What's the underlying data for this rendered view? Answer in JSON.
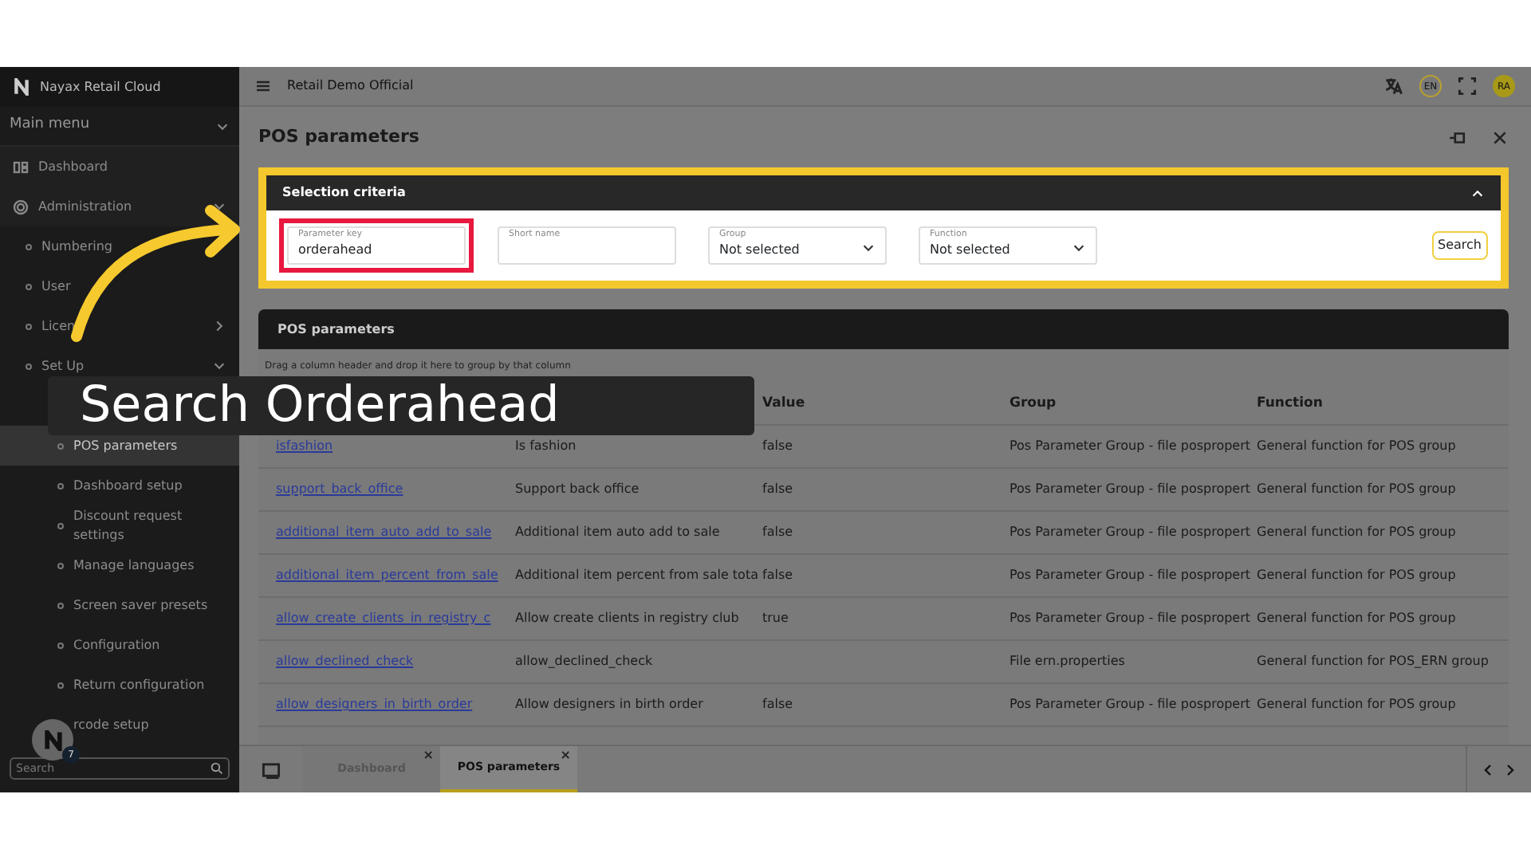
{
  "sidebar": {
    "brand": "Nayax Retail Cloud",
    "main_menu": "Main menu",
    "search": {
      "placeholder": "Search"
    },
    "help_badge": "7",
    "items": [
      {
        "label": "Dashboard",
        "kind": "top",
        "selected": false
      },
      {
        "label": "Administration",
        "kind": "top",
        "expanded": true,
        "selected": false,
        "children": [
          {
            "label": "Numbering",
            "kind": "sub",
            "expanded": false,
            "selected": false
          },
          {
            "label": "User",
            "kind": "sub",
            "selected": false
          },
          {
            "label": "Licen",
            "kind": "sub",
            "expanded": false,
            "selected": false
          },
          {
            "label": "Set Up",
            "kind": "sub",
            "expanded": true,
            "selected": false,
            "children": [
              {
                "label": "POS parameters",
                "kind": "leaf",
                "selected": true
              },
              {
                "label": "Dashboard setup",
                "kind": "leaf",
                "selected": false
              },
              {
                "label": "Discount request settings",
                "kind": "leaf",
                "selected": false
              },
              {
                "label": "Manage languages",
                "kind": "leaf",
                "selected": false
              },
              {
                "label": "Screen saver presets",
                "kind": "leaf",
                "selected": false
              },
              {
                "label": "Configuration",
                "kind": "leaf",
                "selected": false
              },
              {
                "label": "Return configuration",
                "kind": "leaf",
                "selected": false
              },
              {
                "label": "rcode setup",
                "kind": "leaf",
                "selected": false
              }
            ]
          }
        ]
      }
    ]
  },
  "topbar": {
    "title": "Retail Demo Official",
    "language": "EN",
    "avatar": "RA"
  },
  "page": {
    "title": "POS parameters"
  },
  "selection": {
    "title": "Selection criteria",
    "expanded": true,
    "fields": [
      {
        "kind": "text",
        "label": "Parameter key",
        "value": "orderahead",
        "highlighted": true
      },
      {
        "kind": "text",
        "label": "Short name",
        "highlighted": false
      },
      {
        "kind": "select",
        "label": "Group",
        "value": "Not selected",
        "highlighted": false
      },
      {
        "kind": "select",
        "label": "Function",
        "value": "Not selected",
        "highlighted": false
      }
    ],
    "button": "Search"
  },
  "grid": {
    "title": "POS parameters",
    "group_hint": "Drag a column header and drop it here to group by that column",
    "columns": [
      "",
      "",
      "Value",
      "Group",
      "Function"
    ],
    "rows": [
      [
        "isfashion",
        "Is fashion",
        "false",
        "Pos Parameter Group - file pospropert",
        "General function for POS group"
      ],
      [
        "support_back_office",
        "Support back office",
        "false",
        "Pos Parameter Group - file pospropert",
        "General function for POS group"
      ],
      [
        "additional_item_auto_add_to_sale",
        "Additional item auto add to sale",
        "false",
        "Pos Parameter Group - file pospropert",
        "General function for POS group"
      ],
      [
        "additional_item_percent_from_sale",
        "Additional item percent from sale tota",
        "false",
        "Pos Parameter Group - file pospropert",
        "General function for POS group"
      ],
      [
        "allow_create_clients_in_registry_c",
        "Allow create clients in registry club",
        "true",
        "Pos Parameter Group - file pospropert",
        "General function for POS group"
      ],
      [
        "allow_declined_check",
        "allow_declined_check",
        "",
        "File ern.properties",
        "General function for POS_ERN group"
      ],
      [
        "allow_designers_in_birth_order",
        "Allow designers in birth order",
        "false",
        "Pos Parameter Group - file pospropert",
        "General function for POS group"
      ]
    ]
  },
  "tabs": [
    {
      "label": "Dashboard",
      "close": "×",
      "selected": false
    },
    {
      "label": "POS parameters",
      "close": "×",
      "selected": true
    }
  ],
  "caption": "Search Orderahead"
}
